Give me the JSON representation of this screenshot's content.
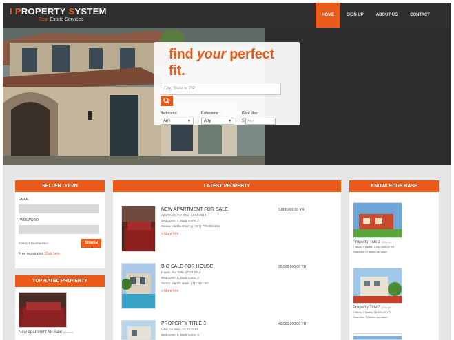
{
  "brand": {
    "title_first_letter": "I",
    "title_p": "P",
    "title_mid": "ROPERTY ",
    "title_s": "S",
    "title_end": "YSTEM",
    "subtitle_real": "Real",
    "subtitle_estate": " Estate",
    "subtitle_services": " Services",
    "accent_color": "#ec5a1a"
  },
  "nav": {
    "items": [
      {
        "label": "HOME",
        "active": true
      },
      {
        "label": "SIGN UP"
      },
      {
        "label": "ABOUT US"
      },
      {
        "label": "CONTACT"
      }
    ]
  },
  "search": {
    "title_a": "find ",
    "title_b": "your",
    "title_c": " perfect fit.",
    "placeholder": "City, State or ZIP",
    "button_icon": "search-icon",
    "bedrooms_label": "Bedrooms:",
    "bedrooms_value": "Any",
    "bathrooms_label": "Bathrooms:",
    "bathrooms_value": "Any",
    "price_label": "Price Max:",
    "price_currency": "$",
    "price_placeholder": "Any"
  },
  "login": {
    "heading": "SELLER LOGIN",
    "email_label": "EMAIL",
    "password_label": "PASSWORD",
    "forgot": "FORGOT PASSWORD?",
    "signin": "SIGN IN",
    "free_reg": "Free registration ",
    "click_here": "Click here"
  },
  "top_rated": {
    "heading": "TOP RATED PROPERTY",
    "caption": "New apartment for Sale",
    "caption_small": "(Owner)"
  },
  "latest": {
    "heading": "LATEST PROPERTY",
    "more": "» More Info",
    "items": [
      {
        "title": "NEW APARTMENT FOR SALE",
        "line1": "Apartment, For Sale, 14.03.2014",
        "line2": "Bedrooms: 3, Bathrooms: 2",
        "line3": "Sanaa, Hadda street | (+967) 773-059-813",
        "price": "5,000,000.00 YR"
      },
      {
        "title": "BIG SALE FOR HOUSE",
        "line1": "House, For Sale, 27.03.2014",
        "line2": "Bedrooms: 5, Bathrooms: 3",
        "line3": "Sanaa, Hadda street | 711-344-924",
        "price": "20,000,000.00 YR"
      },
      {
        "title": "PROPERTY TITLE 3",
        "line1": "Villa, For Sale, 24.03.2014",
        "line2": "Bedrooms: 6, Bathrooms: 3",
        "line3": "",
        "price": "40,000,000.00 YR"
      }
    ]
  },
  "knowledge": {
    "heading": "KNOWLEDGE BASE",
    "items": [
      {
        "title": "Property Title 2",
        "small": "(Owner)",
        "line1": "7 Beds, 4 Baths: 7,000,000.00 YR",
        "line2": "Searched 27 times as 'good'"
      },
      {
        "title": "Property Title 3",
        "small": "(Owner)",
        "line1": "5 Beds, 3 Baths: 35,000.00 YR",
        "line2": "Searched 19 times as 'same'"
      }
    ]
  }
}
